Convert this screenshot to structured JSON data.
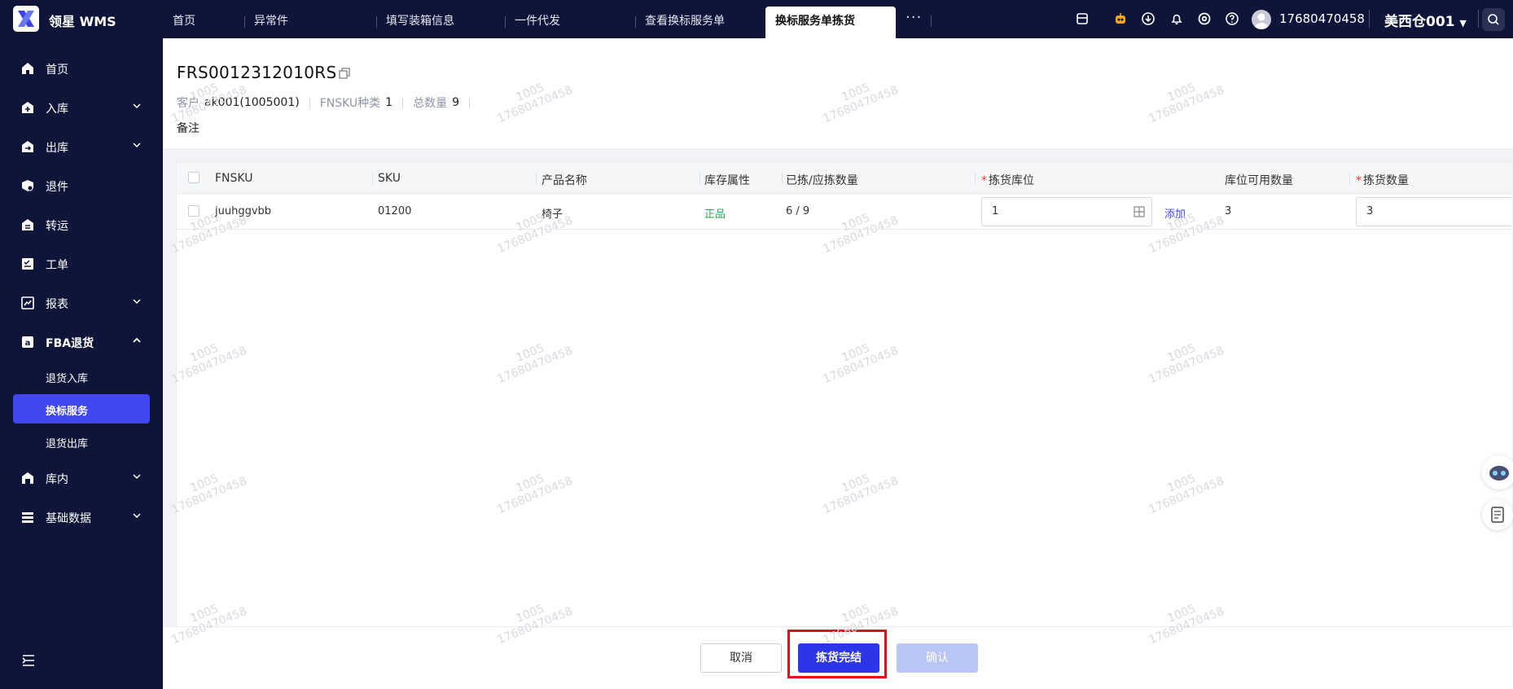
{
  "app": {
    "name": "领星 WMS"
  },
  "tabs": [
    "首页",
    "异常件",
    "填写装箱信息",
    "一件代发",
    "查看换标服务单",
    "换标服务单拣货"
  ],
  "active_tab": "换标服务单拣货",
  "topbar": {
    "more": "···",
    "user_phone": "17680470458",
    "warehouse": "美西仓001",
    "icons": [
      "store-icon",
      "robot-icon",
      "download-icon",
      "bell-icon",
      "settings-icon",
      "help-icon",
      "user-avatar",
      "search-icon"
    ]
  },
  "sidebar": {
    "items": [
      {
        "label": "首页",
        "icon": "home-icon",
        "expandable": false
      },
      {
        "label": "入库",
        "icon": "inbound-icon",
        "expandable": true
      },
      {
        "label": "出库",
        "icon": "outbound-icon",
        "expandable": true
      },
      {
        "label": "退件",
        "icon": "return-icon",
        "expandable": false
      },
      {
        "label": "转运",
        "icon": "transfer-icon",
        "expandable": false
      },
      {
        "label": "工单",
        "icon": "workorder-icon",
        "expandable": false
      },
      {
        "label": "报表",
        "icon": "report-icon",
        "expandable": true
      },
      {
        "label": "FBA退货",
        "icon": "fba-icon",
        "expandable": true,
        "expanded": true
      },
      {
        "label": "库内",
        "icon": "warehouse-icon",
        "expandable": true
      },
      {
        "label": "基础数据",
        "icon": "data-icon",
        "expandable": true
      }
    ],
    "fba_sub": [
      "退货入库",
      "换标服务",
      "退货出库"
    ],
    "active_sub": "换标服务"
  },
  "order": {
    "number": "FRS0012312010RS",
    "customer_label": "客户",
    "customer_value": "ak001(1005001)",
    "fnsku_label": "FNSKU种类",
    "fnsku_value": "1",
    "total_label": "总数量",
    "total_value": "9",
    "remark_label": "备注"
  },
  "table": {
    "headers": {
      "fnsku": "FNSKU",
      "sku": "SKU",
      "product_name": "产品名称",
      "stock_attr": "库存属性",
      "picked_qty": "已拣/应拣数量",
      "pick_location": "拣货库位",
      "available_qty": "库位可用数量",
      "pick_qty": "拣货数量"
    },
    "required_mark": "*",
    "rows": [
      {
        "fnsku": "juuhggvbb",
        "sku": "01200",
        "product_name": "椅子",
        "stock_attr": "正品",
        "picked_qty": "6 / 9",
        "pick_location": "1",
        "add_link": "添加",
        "available_qty": "3",
        "pick_qty": "3"
      }
    ]
  },
  "footer": {
    "cancel": "取消",
    "finish": "拣货完结",
    "confirm": "确认"
  },
  "watermark": {
    "line1": "1005",
    "line2": "17680470458"
  },
  "colors": {
    "sidebar_bg": "#0e1538",
    "accent": "#2d35e8",
    "active_nav": "#4046f0",
    "highlight_box": "#e0101a",
    "good_stock": "#2fa84f"
  }
}
